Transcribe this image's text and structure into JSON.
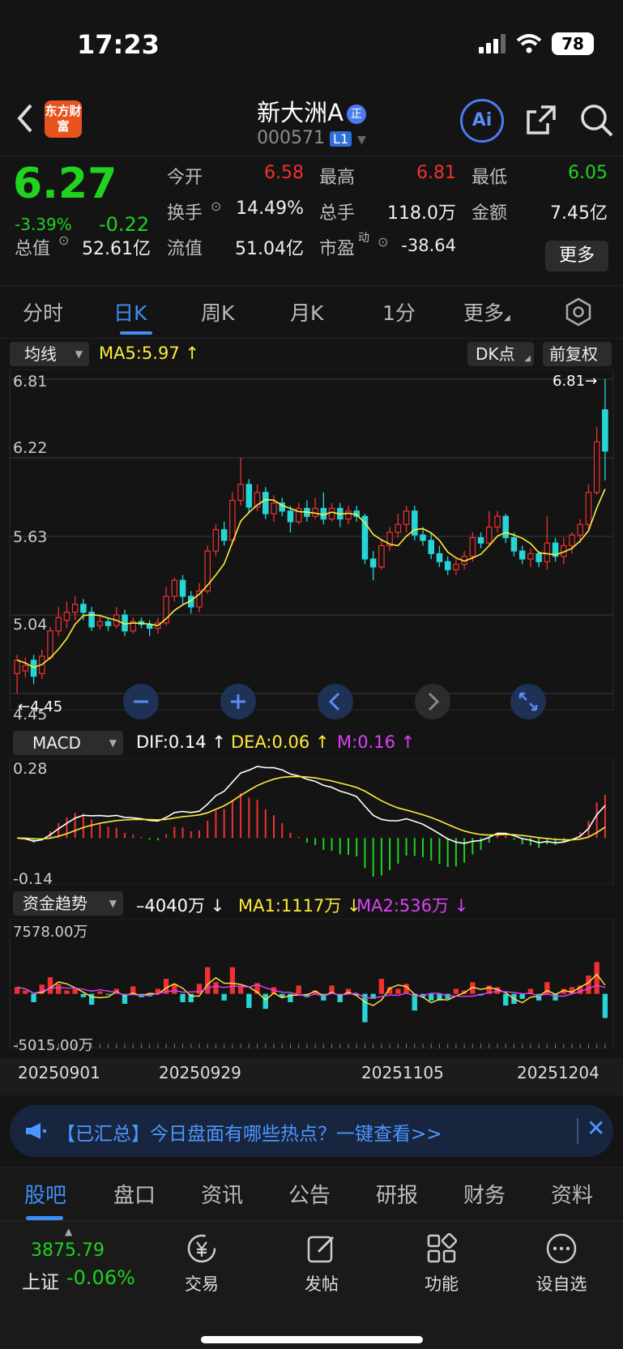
{
  "status": {
    "time": "17:23",
    "battery": "78"
  },
  "header": {
    "name": "新大洲A",
    "name_tag": "正",
    "code": "000571",
    "level": "L1",
    "logo": "东方财富",
    "ai_label": "Ai",
    "icons": {
      "back": "back-chevron-icon",
      "share": "share-icon",
      "search": "search-icon"
    }
  },
  "quote": {
    "price": "6.27",
    "change_pct": "-3.39%",
    "change_abs": "-0.22",
    "open_label": "今开",
    "open": "6.58",
    "high_label": "最高",
    "high": "6.81",
    "low_label": "最低",
    "low": "6.05",
    "turnover_label": "换手",
    "turnover": "14.49%",
    "volume_label": "总手",
    "volume": "118.0万",
    "amount_label": "金额",
    "amount": "7.45亿",
    "mcap_label": "总值",
    "mcap": "52.61亿",
    "float_label": "流值",
    "float": "51.04亿",
    "pe_label": "市盈",
    "pe_suffix": "动",
    "pe": "-38.64",
    "more_label": "更多"
  },
  "period_tabs": [
    "分时",
    "日K",
    "周K",
    "月K",
    "1分",
    "更多"
  ],
  "main_chart": {
    "indicator_button": "均线",
    "ma5_text": "MA5:5.97 ↑",
    "dk_button": "DK点",
    "adjust_button": "前复权",
    "y_ticks": [
      "6.81",
      "6.22",
      "5.63",
      "5.04",
      "4.45"
    ],
    "high_marker": "6.81→",
    "low_marker": "←4.45",
    "controls": [
      "zoom-out-icon",
      "zoom-in-icon",
      "scroll-left-icon",
      "scroll-right-icon",
      "fullscreen-icon"
    ]
  },
  "macd": {
    "indicator_button": "MACD",
    "dif": "DIF:0.14 ↑",
    "dea": "DEA:0.06 ↑",
    "m": "M:0.16 ↑",
    "y_top": "0.28",
    "y_bottom": "-0.14"
  },
  "fund": {
    "indicator_button": "资金趋势",
    "value": "–4040万 ↓",
    "ma1": "MA1:1117万 ↓",
    "ma2": "MA2:536万 ↓",
    "y_top": "7578.00万",
    "y_bottom": "-5015.00万"
  },
  "dates": [
    "20250901",
    "20250929",
    "20251105",
    "20251204"
  ],
  "notice": {
    "text": "【已汇总】今日盘面有哪些热点？一键查看>>",
    "icon": "megaphone-icon",
    "close": "✕"
  },
  "bottom_tabs": [
    "股吧",
    "盘口",
    "资讯",
    "公告",
    "研报",
    "财务",
    "资料"
  ],
  "dock": {
    "index_value": "3875.79",
    "index_name": "上证",
    "index_change": "-0.06%",
    "items": [
      {
        "label": "交易",
        "icon": "trade-yen-icon"
      },
      {
        "label": "发帖",
        "icon": "compose-icon"
      },
      {
        "label": "功能",
        "icon": "apps-grid-icon"
      },
      {
        "label": "设自选",
        "icon": "more-dots-icon"
      }
    ]
  },
  "colors": {
    "up": "#f23030",
    "down": "#1fd31f",
    "candle_down": "#26d6d6",
    "accent": "#3f8ef5",
    "ma5": "#ffeb3b",
    "dif": "#ffffff",
    "dea": "#ffeb3b",
    "ma2": "#e040fb"
  },
  "chart_data": {
    "type": "candlestick",
    "x_labels": [
      "20250901",
      "20250929",
      "20251105",
      "20251204"
    ],
    "y_range": [
      4.45,
      6.81
    ],
    "candles": [
      [
        4.6,
        4.7,
        4.45,
        4.74
      ],
      [
        4.62,
        4.66,
        4.57,
        4.72
      ],
      [
        4.7,
        4.58,
        4.52,
        4.74
      ],
      [
        4.6,
        4.73,
        4.56,
        4.78
      ],
      [
        4.72,
        4.92,
        4.7,
        4.95
      ],
      [
        4.92,
        5.02,
        4.88,
        5.1
      ],
      [
        5.0,
        5.06,
        4.94,
        5.14
      ],
      [
        5.06,
        5.12,
        5.0,
        5.18
      ],
      [
        5.12,
        5.06,
        5.0,
        5.16
      ],
      [
        5.06,
        4.95,
        4.92,
        5.1
      ],
      [
        4.96,
        4.99,
        4.93,
        5.04
      ],
      [
        4.99,
        4.96,
        4.92,
        5.02
      ],
      [
        4.96,
        5.04,
        4.94,
        5.1
      ],
      [
        5.04,
        4.92,
        4.88,
        5.08
      ],
      [
        4.92,
        4.99,
        4.9,
        5.02
      ],
      [
        4.99,
        4.97,
        4.94,
        5.02
      ],
      [
        4.97,
        4.94,
        4.88,
        5.0
      ],
      [
        4.94,
        4.98,
        4.9,
        5.02
      ],
      [
        4.98,
        5.18,
        4.96,
        5.25
      ],
      [
        5.18,
        5.3,
        5.14,
        5.32
      ],
      [
        5.3,
        5.18,
        5.12,
        5.34
      ],
      [
        5.18,
        5.1,
        5.05,
        5.22
      ],
      [
        5.1,
        5.22,
        5.06,
        5.28
      ],
      [
        5.22,
        5.52,
        5.2,
        5.56
      ],
      [
        5.52,
        5.68,
        5.48,
        5.72
      ],
      [
        5.68,
        5.6,
        5.56,
        5.74
      ],
      [
        5.6,
        5.9,
        5.58,
        5.96
      ],
      [
        5.9,
        6.02,
        5.86,
        6.22
      ],
      [
        6.02,
        5.85,
        5.8,
        6.06
      ],
      [
        5.85,
        5.96,
        5.82,
        6.02
      ],
      [
        5.96,
        5.8,
        5.76,
        6.0
      ],
      [
        5.8,
        5.88,
        5.74,
        5.94
      ],
      [
        5.88,
        5.82,
        5.78,
        5.92
      ],
      [
        5.82,
        5.74,
        5.66,
        5.86
      ],
      [
        5.74,
        5.84,
        5.72,
        5.88
      ],
      [
        5.84,
        5.78,
        5.74,
        5.9
      ],
      [
        5.78,
        5.84,
        5.76,
        5.92
      ],
      [
        5.84,
        5.76,
        5.72,
        5.96
      ],
      [
        5.76,
        5.84,
        5.74,
        5.88
      ],
      [
        5.84,
        5.76,
        5.7,
        5.88
      ],
      [
        5.76,
        5.82,
        5.72,
        5.86
      ],
      [
        5.82,
        5.78,
        5.74,
        5.86
      ],
      [
        5.78,
        5.46,
        5.42,
        5.8
      ],
      [
        5.46,
        5.4,
        5.3,
        5.52
      ],
      [
        5.4,
        5.56,
        5.38,
        5.6
      ],
      [
        5.56,
        5.66,
        5.52,
        5.7
      ],
      [
        5.66,
        5.72,
        5.62,
        5.8
      ],
      [
        5.72,
        5.82,
        5.66,
        5.86
      ],
      [
        5.82,
        5.64,
        5.6,
        5.86
      ],
      [
        5.64,
        5.6,
        5.56,
        5.7
      ],
      [
        5.6,
        5.5,
        5.46,
        5.66
      ],
      [
        5.5,
        5.44,
        5.4,
        5.56
      ],
      [
        5.44,
        5.38,
        5.34,
        5.48
      ],
      [
        5.38,
        5.42,
        5.34,
        5.46
      ],
      [
        5.42,
        5.48,
        5.38,
        5.52
      ],
      [
        5.48,
        5.62,
        5.44,
        5.66
      ],
      [
        5.62,
        5.58,
        5.54,
        5.66
      ],
      [
        5.58,
        5.7,
        5.56,
        5.82
      ],
      [
        5.7,
        5.78,
        5.66,
        5.82
      ],
      [
        5.78,
        5.62,
        5.58,
        5.8
      ],
      [
        5.62,
        5.52,
        5.48,
        5.66
      ],
      [
        5.52,
        5.46,
        5.42,
        5.56
      ],
      [
        5.46,
        5.5,
        5.4,
        5.54
      ],
      [
        5.5,
        5.44,
        5.4,
        5.52
      ],
      [
        5.44,
        5.58,
        5.38,
        5.78
      ],
      [
        5.58,
        5.48,
        5.44,
        5.62
      ],
      [
        5.48,
        5.56,
        5.42,
        5.62
      ],
      [
        5.56,
        5.64,
        5.5,
        5.66
      ],
      [
        5.64,
        5.72,
        5.58,
        5.76
      ],
      [
        5.72,
        5.96,
        5.68,
        6.02
      ],
      [
        5.96,
        6.34,
        5.94,
        6.45
      ],
      [
        6.58,
        6.27,
        6.05,
        6.81
      ]
    ]
  }
}
